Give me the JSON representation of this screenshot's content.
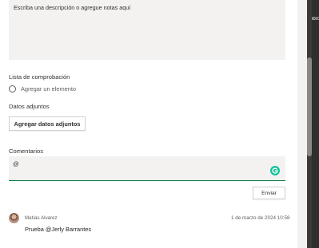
{
  "description": {
    "placeholder": "Escriba una descripción o agregue notas aquí"
  },
  "checklist": {
    "title": "Lista de comprobación",
    "add_item_label": "Agregar un elemento"
  },
  "attachments": {
    "title": "Datos adjuntos",
    "add_button_label": "Agregar datos adjuntos"
  },
  "comments": {
    "title": "Comentarios",
    "input_value": "@",
    "send_label": "Enviar",
    "items": [
      {
        "author": "Matías Alvarez",
        "timestamp": "1 de marzo de 2024 10:58",
        "text": "Prueba @Jerly Barrantes"
      }
    ]
  },
  "background_fragment": "ibro",
  "colors": {
    "accent_green": "#107c41",
    "grammarly_green": "#15c39a",
    "field_bg": "#f3f2f1"
  },
  "icons": {
    "grammarly": "grammarly-icon",
    "avatar": "user-avatar"
  }
}
